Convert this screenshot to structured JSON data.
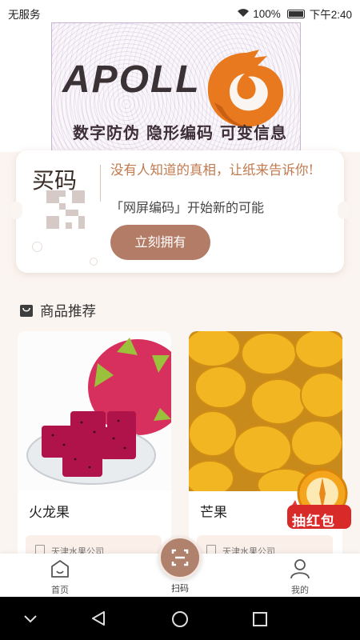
{
  "status_bar": {
    "carrier": "无服务",
    "battery": "100%",
    "time": "下午2:40"
  },
  "banner": {
    "brand": "APOLL",
    "slogan": "数字防伪 隐形编码 可变信息",
    "colors": {
      "accent": "#e8791e"
    }
  },
  "promo": {
    "title": "买码",
    "tagline": "没有人知道的真相，让纸来告诉你!",
    "subline": "「网屏编码」开始新的可能",
    "button": "立刻拥有"
  },
  "section": {
    "icon": "shopping-bag-icon",
    "title": "商品推荐"
  },
  "products": [
    {
      "name": "火龙果",
      "company": "天津水果公司"
    },
    {
      "name": "芒果",
      "company": "天津水果公司"
    }
  ],
  "float_badge": "抽红包",
  "bottom_nav": {
    "home": "首页",
    "scan": "扫码",
    "mine": "我的"
  },
  "system_nav": [
    "back-icon",
    "home-icon",
    "recents-icon"
  ]
}
